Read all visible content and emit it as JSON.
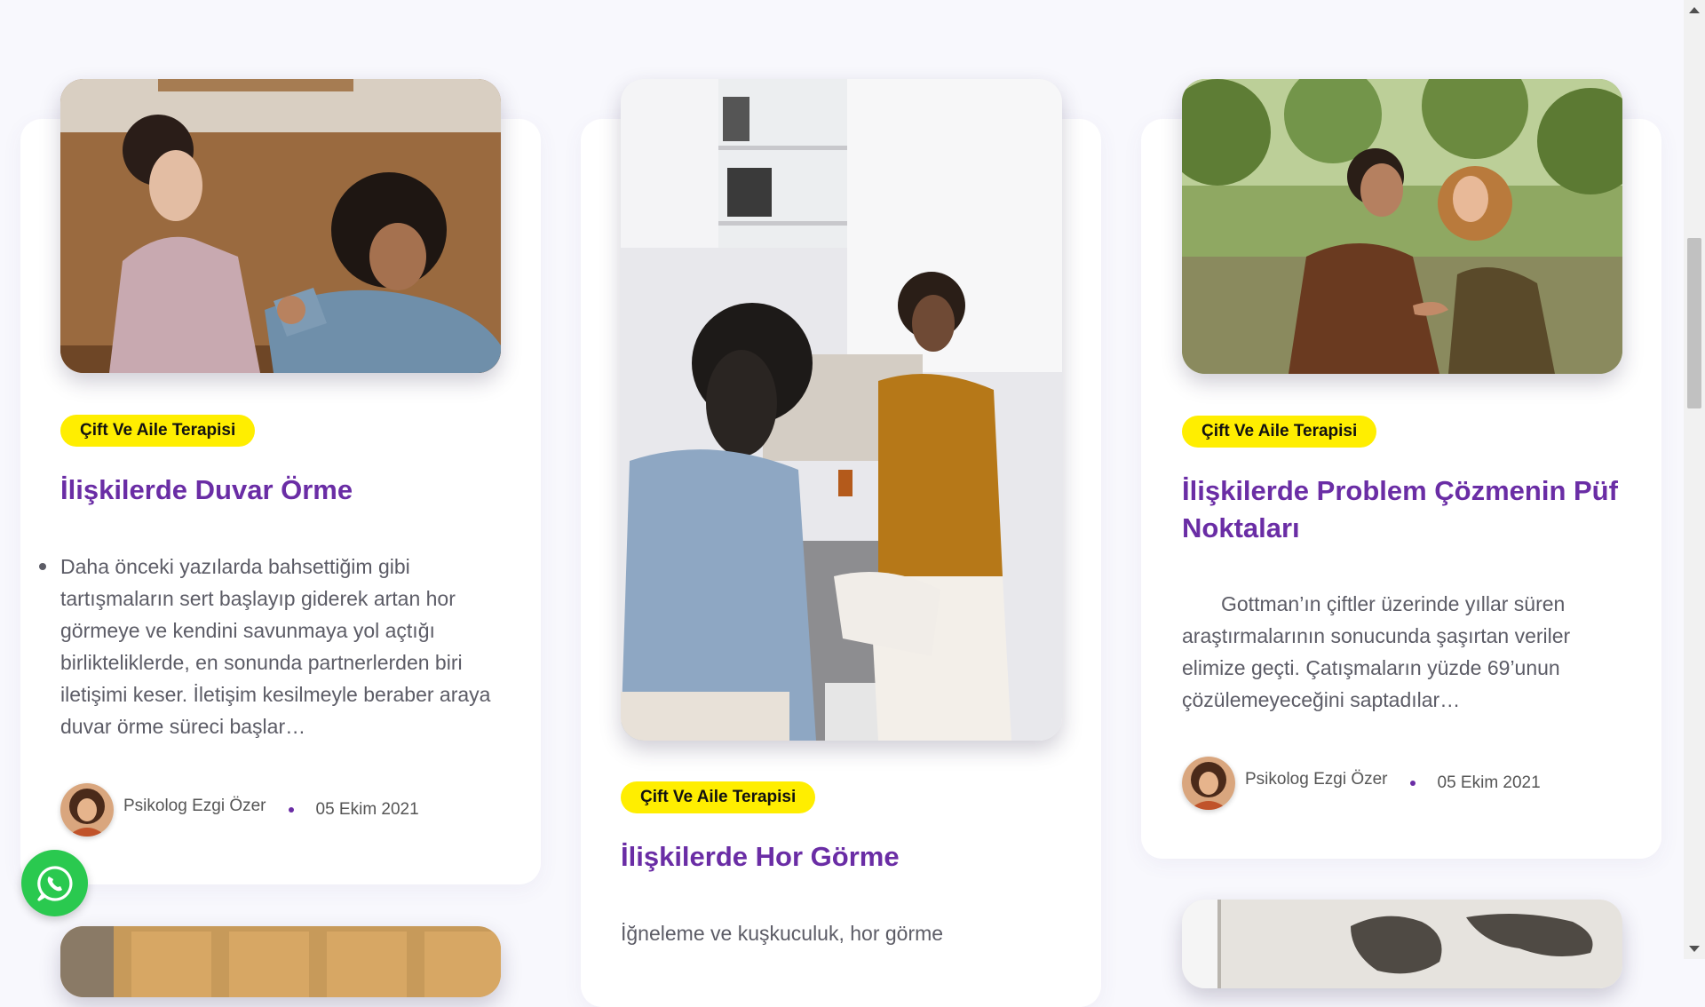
{
  "posts": [
    {
      "category": "Çift Ve Aile Terapisi",
      "title": "İlişkilerde Duvar Örme",
      "excerpt": "Daha önceki yazılarda bahsettiğim gibi tartışmaların sert başlayıp giderek artan hor görmeye ve kendini savunmaya yol açtığı birlikteliklerde, en sonunda partnerlerden biri iletişimi keser. İletişim kesilmeyle beraber araya duvar örme süreci başlar…",
      "author": "Psikolog Ezgi Özer",
      "date": "05 Ekim 2021"
    },
    {
      "category": "Çift Ve Aile Terapisi",
      "title": "İlişkilerde Hor Görme",
      "excerpt": "İğneleme ve kuşkuculuk, hor görme"
    },
    {
      "category": "Çift Ve Aile Terapisi",
      "title": "İlişkilerde Problem Çözmenin Püf Noktaları",
      "excerpt": "Gottman’ın  çiftler üzerinde yıllar süren araştırmalarının sonucunda şaşırtan veriler elimize geçti. Çatışmaların yüzde 69’unun çözülemeyeceğini saptadılar…",
      "author": "Psikolog Ezgi Özer",
      "date": "05 Ekim 2021"
    }
  ],
  "icons": {
    "whatsapp": "whatsapp-icon",
    "scroll_up": "chevron-up-icon",
    "scroll_down": "chevron-down-icon"
  },
  "colors": {
    "accent": "#6a2da5",
    "tag_bg": "#ffee00",
    "whatsapp": "#2ac94f",
    "page_bg": "#f8f8fd"
  }
}
